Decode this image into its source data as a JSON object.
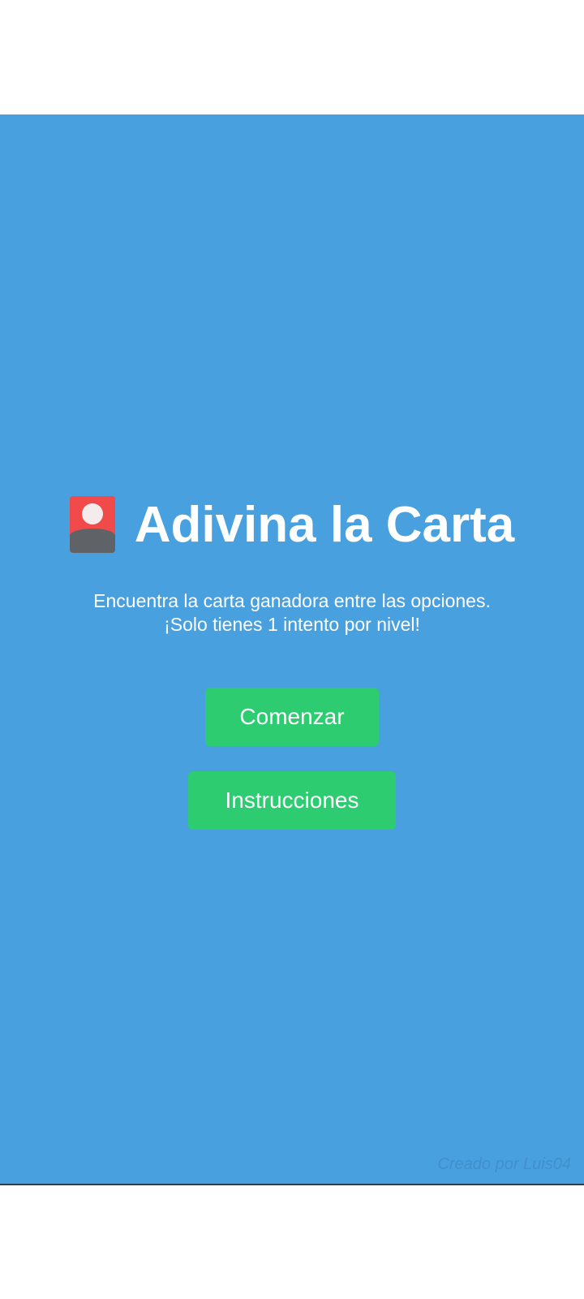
{
  "app": {
    "background_color": "#49a0de",
    "button_color": "#2ecc71"
  },
  "header": {
    "icon": "joker-card-icon",
    "title": "Adivina la Carta"
  },
  "description": {
    "line1": "Encuentra la carta ganadora entre las opciones.",
    "line2": "¡Solo tienes 1 intento por nivel!"
  },
  "buttons": {
    "start_label": "Comenzar",
    "instructions_label": "Instrucciones"
  },
  "footer": {
    "credit": "Creado por Luis04"
  }
}
